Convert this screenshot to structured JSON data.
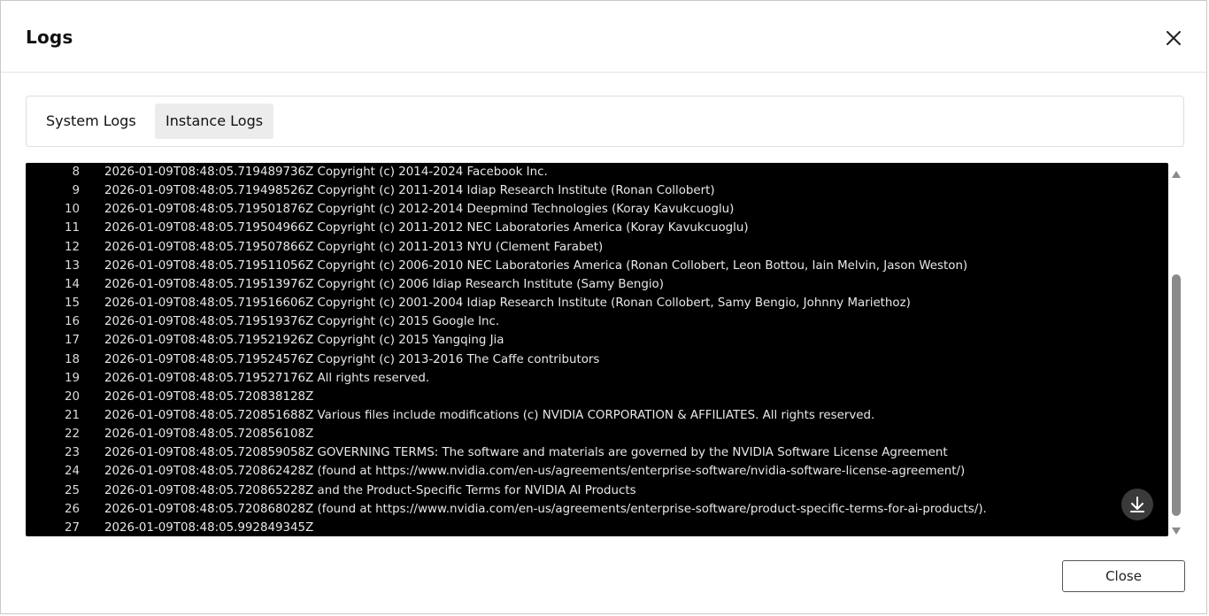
{
  "dialog": {
    "title": "Logs",
    "close_icon": "close-icon",
    "close_button_label": "Close"
  },
  "tabs": [
    {
      "label": "System Logs",
      "active": false
    },
    {
      "label": "Instance Logs",
      "active": true
    }
  ],
  "logs": [
    {
      "num": "8",
      "text": "2026-01-09T08:48:05.719489736Z Copyright (c) 2014-2024 Facebook Inc."
    },
    {
      "num": "9",
      "text": "2026-01-09T08:48:05.719498526Z Copyright (c) 2011-2014 Idiap Research Institute (Ronan Collobert)"
    },
    {
      "num": "10",
      "text": "2026-01-09T08:48:05.719501876Z Copyright (c) 2012-2014 Deepmind Technologies (Koray Kavukcuoglu)"
    },
    {
      "num": "11",
      "text": "2026-01-09T08:48:05.719504966Z Copyright (c) 2011-2012 NEC Laboratories America (Koray Kavukcuoglu)"
    },
    {
      "num": "12",
      "text": "2026-01-09T08:48:05.719507866Z Copyright (c) 2011-2013 NYU (Clement Farabet)"
    },
    {
      "num": "13",
      "text": "2026-01-09T08:48:05.719511056Z Copyright (c) 2006-2010 NEC Laboratories America (Ronan Collobert, Leon Bottou, Iain Melvin, Jason Weston)"
    },
    {
      "num": "14",
      "text": "2026-01-09T08:48:05.719513976Z Copyright (c) 2006 Idiap Research Institute (Samy Bengio)"
    },
    {
      "num": "15",
      "text": "2026-01-09T08:48:05.719516606Z Copyright (c) 2001-2004 Idiap Research Institute (Ronan Collobert, Samy Bengio, Johnny Mariethoz)"
    },
    {
      "num": "16",
      "text": "2026-01-09T08:48:05.719519376Z Copyright (c) 2015 Google Inc."
    },
    {
      "num": "17",
      "text": "2026-01-09T08:48:05.719521926Z Copyright (c) 2015 Yangqing Jia"
    },
    {
      "num": "18",
      "text": "2026-01-09T08:48:05.719524576Z Copyright (c) 2013-2016 The Caffe contributors"
    },
    {
      "num": "19",
      "text": "2026-01-09T08:48:05.719527176Z All rights reserved."
    },
    {
      "num": "20",
      "text": "2026-01-09T08:48:05.720838128Z"
    },
    {
      "num": "21",
      "text": "2026-01-09T08:48:05.720851688Z Various files include modifications (c) NVIDIA CORPORATION & AFFILIATES. All rights reserved."
    },
    {
      "num": "22",
      "text": "2026-01-09T08:48:05.720856108Z"
    },
    {
      "num": "23",
      "text": "2026-01-09T08:48:05.720859058Z GOVERNING TERMS: The software and materials are governed by the NVIDIA Software License Agreement"
    },
    {
      "num": "24",
      "text": "2026-01-09T08:48:05.720862428Z (found at https://www.nvidia.com/en-us/agreements/enterprise-software/nvidia-software-license-agreement/)"
    },
    {
      "num": "25",
      "text": "2026-01-09T08:48:05.720865228Z and the Product-Specific Terms for NVIDIA AI Products"
    },
    {
      "num": "26",
      "text": "2026-01-09T08:48:05.720868028Z (found at https://www.nvidia.com/en-us/agreements/enterprise-software/product-specific-terms-for-ai-products/)."
    },
    {
      "num": "27",
      "text": "2026-01-09T08:48:05.992849345Z"
    }
  ],
  "icons": {
    "download": "download-icon",
    "scroll_up": "scroll-up-arrow-icon",
    "scroll_down": "scroll-down-arrow-icon"
  }
}
